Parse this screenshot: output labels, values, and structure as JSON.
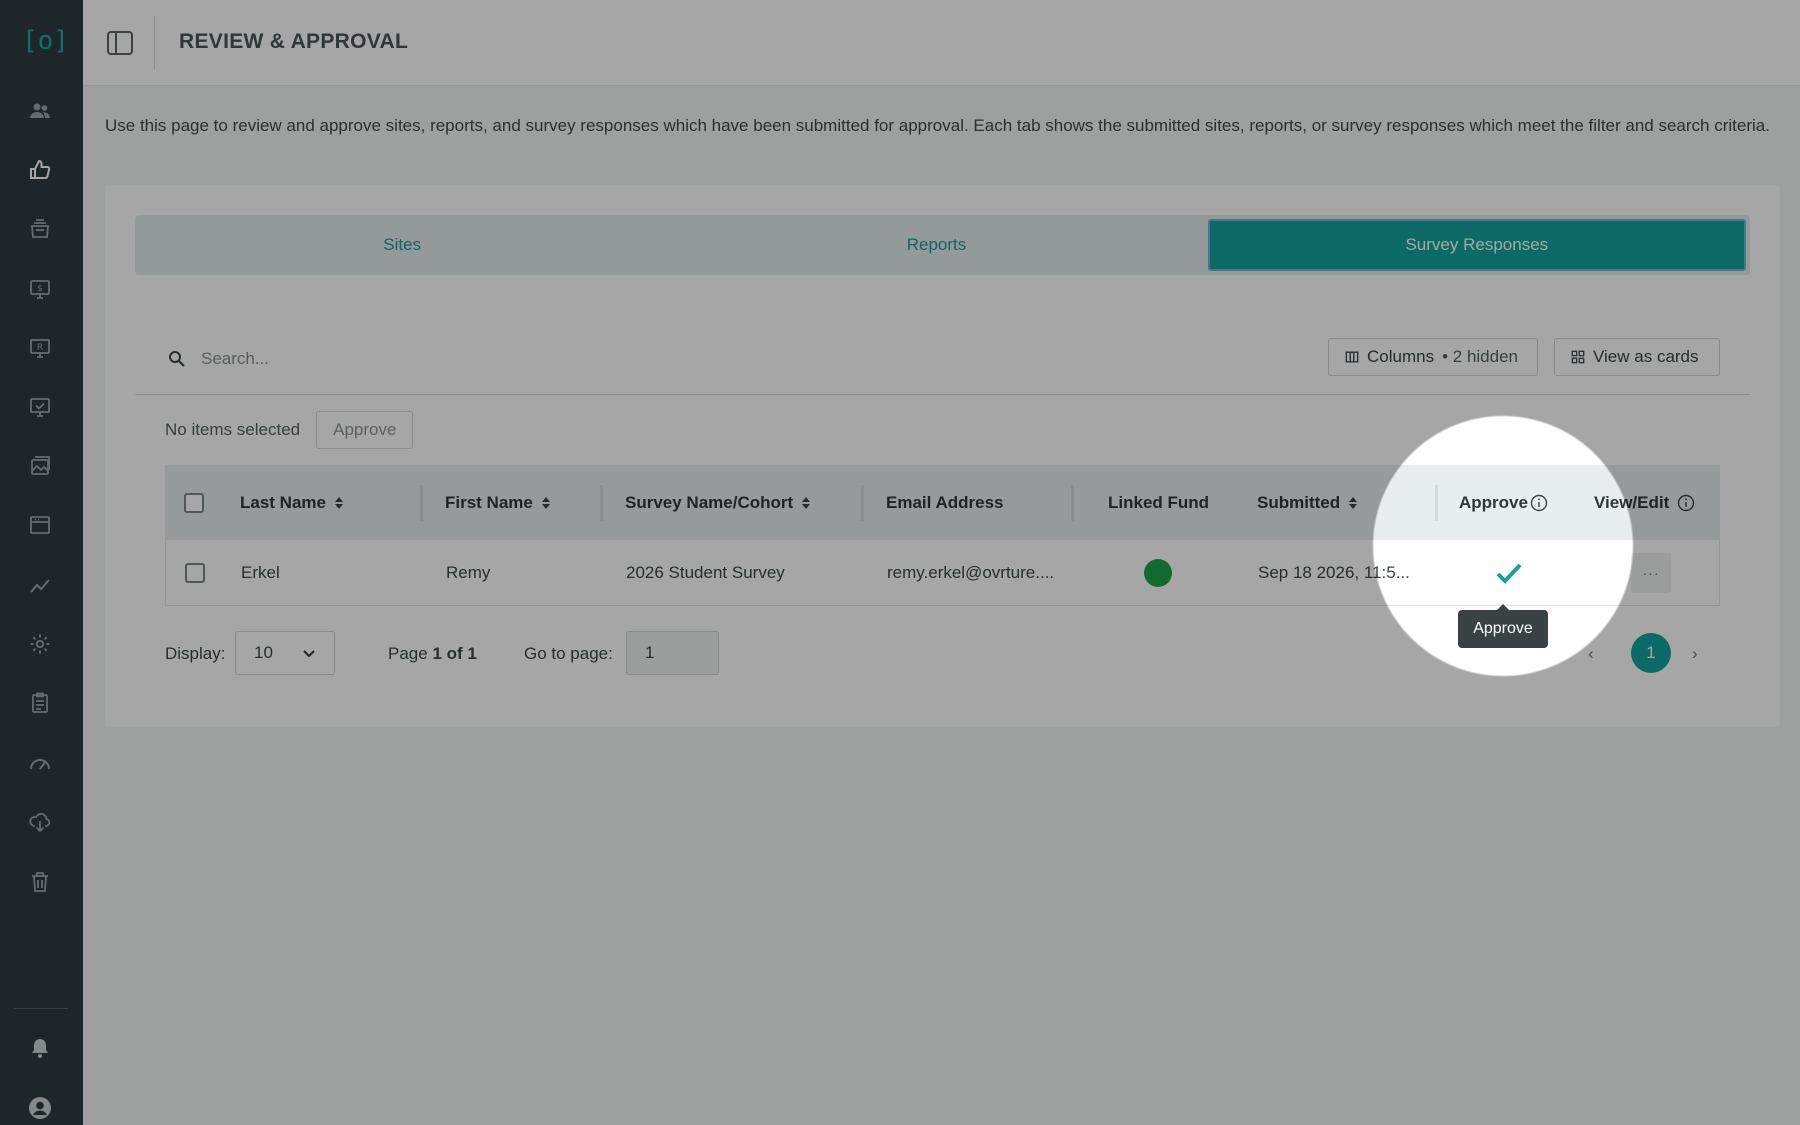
{
  "header": {
    "title": "REVIEW & APPROVAL"
  },
  "description": "Use this page to review and approve sites, reports, and survey responses which have been submitted for approval. Each tab shows the submitted sites, reports, or survey responses which meet the filter and search criteria.",
  "tabs": [
    {
      "label": "Sites",
      "active": false
    },
    {
      "label": "Reports",
      "active": false
    },
    {
      "label": "Survey Responses",
      "active": true
    }
  ],
  "search": {
    "placeholder": "Search..."
  },
  "toolbar": {
    "columns_label": "Columns",
    "hidden_label": "• 2 hidden",
    "cards_label": "View as cards"
  },
  "selection": {
    "status": "No items selected",
    "approve_label": "Approve"
  },
  "table": {
    "headers": {
      "last_name": "Last Name",
      "first_name": "First Name",
      "survey": "Survey Name/Cohort",
      "email": "Email Address",
      "linked_fund": "Linked Fund",
      "submitted": "Submitted",
      "approve": "Approve",
      "view_edit": "View/Edit"
    },
    "rows": [
      {
        "last_name": "Erkel",
        "first_name": "Remy",
        "survey": "2026 Student Survey",
        "email": "remy.erkel@ovrture....",
        "linked_fund_color": "#1aa24a",
        "submitted": "Sep 18 2026, 11:5...",
        "actions": "···"
      }
    ]
  },
  "pagination": {
    "display_label": "Display:",
    "display_value": "10",
    "page_prefix": "Page",
    "page_current": "1 of 1",
    "goto_label": "Go to page:",
    "goto_value": "1",
    "prev": "‹",
    "current_page": "1",
    "next": "›"
  },
  "tooltip": {
    "text": "Approve"
  },
  "colors": {
    "accent": "#13a39c",
    "sidebar": "#2c3a3e",
    "fund_dot": "#1aa24a"
  }
}
